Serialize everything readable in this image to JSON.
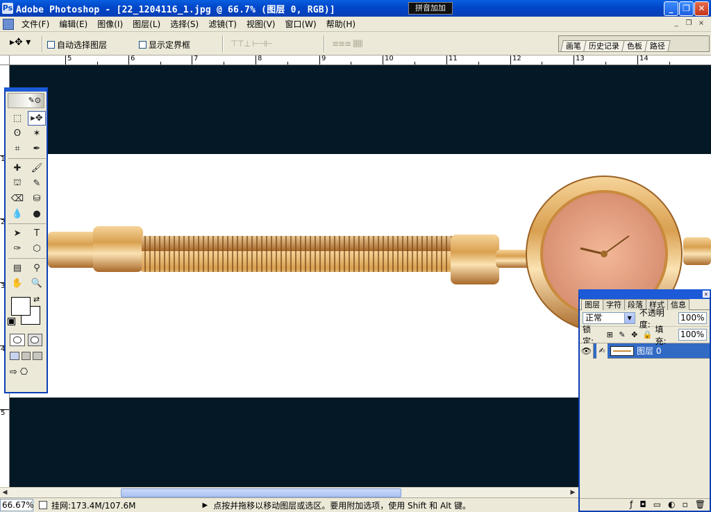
{
  "window": {
    "title": "Adobe Photoshop - [22_1204116_1.jpg @ 66.7% (图层 0, RGB)]",
    "ime_indicator": "拼音加加",
    "btn_min": "_",
    "btn_max": "❐",
    "btn_close": "✕"
  },
  "menu": {
    "items": [
      "文件(F)",
      "编辑(E)",
      "图像(I)",
      "图层(L)",
      "选择(S)",
      "滤镜(T)",
      "视图(V)",
      "窗口(W)",
      "帮助(H)"
    ],
    "doc_min": "_",
    "doc_restore": "❐",
    "doc_close": "×"
  },
  "options": {
    "tool_preset_icon": "move-tool-icon",
    "tool_preset_glyph": "▸✥ ▾",
    "auto_select_label": "自动选择图层",
    "show_bounds_label": "显示定界框",
    "align_glyphs": "⊤⊤⊥ ⊢⊣⊢",
    "distribute_glyphs": "≡≡≡ ⫼⫼⫼"
  },
  "palette_well": {
    "tabs": [
      "画笔",
      "历史记录",
      "色板",
      "路径"
    ]
  },
  "ruler": {
    "h_labels": [
      "5",
      "6",
      "7",
      "8",
      "9",
      "10",
      "11",
      "12",
      "13",
      "14"
    ],
    "v_labels": [
      "1",
      "2",
      "3",
      "4",
      "5"
    ]
  },
  "toolbox": {
    "header_glyph": "✎⊙",
    "tools": [
      {
        "name": "marquee-tool-icon",
        "glyph": "⬚",
        "active": false
      },
      {
        "name": "move-tool-icon",
        "glyph": "▸✥",
        "active": true
      },
      {
        "name": "lasso-tool-icon",
        "glyph": "ʘ",
        "active": false
      },
      {
        "name": "magic-wand-tool-icon",
        "glyph": "✶",
        "active": false
      },
      {
        "name": "crop-tool-icon",
        "glyph": "⌗",
        "active": false
      },
      {
        "name": "slice-tool-icon",
        "glyph": "✒",
        "active": false
      },
      {
        "name": "healing-brush-tool-icon",
        "glyph": "✚",
        "active": false
      },
      {
        "name": "brush-tool-icon",
        "glyph": "🖌",
        "active": false
      },
      {
        "name": "clone-stamp-tool-icon",
        "glyph": "⛫",
        "active": false
      },
      {
        "name": "history-brush-tool-icon",
        "glyph": "✎",
        "active": false
      },
      {
        "name": "eraser-tool-icon",
        "glyph": "⌫",
        "active": false
      },
      {
        "name": "paint-bucket-tool-icon",
        "glyph": "⛁",
        "active": false
      },
      {
        "name": "blur-tool-icon",
        "glyph": "💧",
        "active": false
      },
      {
        "name": "dodge-tool-icon",
        "glyph": "●",
        "active": false
      },
      {
        "name": "path-selection-tool-icon",
        "glyph": "➤",
        "active": false
      },
      {
        "name": "type-tool-icon",
        "glyph": "T",
        "active": false
      },
      {
        "name": "pen-tool-icon",
        "glyph": "✑",
        "active": false
      },
      {
        "name": "shape-tool-icon",
        "glyph": "⬡",
        "active": false
      },
      {
        "name": "notes-tool-icon",
        "glyph": "▤",
        "active": false
      },
      {
        "name": "eyedropper-tool-icon",
        "glyph": "⚲",
        "active": false
      },
      {
        "name": "hand-tool-icon",
        "glyph": "✋",
        "active": false
      },
      {
        "name": "zoom-tool-icon",
        "glyph": "🔍",
        "active": false
      }
    ],
    "swap_glyph": "⇄",
    "jump_glyphs": [
      "⇨",
      "⎔"
    ]
  },
  "layers_panel": {
    "close_glyph": "x",
    "tabs": [
      "图层",
      "字符",
      "段落",
      "样式",
      "信息"
    ],
    "blend_mode": "正常",
    "blend_dropdown_glyph": "▼",
    "opacity_label": "不透明度:",
    "opacity_value": "100%",
    "lock_label": "锁定:",
    "lock_glyphs": [
      "⊞",
      "✎",
      "✥",
      "🔒"
    ],
    "fill_label": "填充:",
    "fill_value": "100%",
    "layer": {
      "name": "图层 0",
      "visible_glyph": "👁",
      "brush_glyph": "✍"
    },
    "footer_glyphs": [
      "ƒ",
      "◘",
      "▭",
      "◐",
      "▫",
      "🗑"
    ]
  },
  "statusbar": {
    "zoom": "66.67%",
    "doc_info": "挂网:173.4M/107.6M",
    "play_glyph": "▶",
    "hint": "点按并拖移以移动图层或选区。要用附加选项，使用 Shift 和 Alt 键。"
  },
  "scrollbar": {
    "left_arrow": "◀",
    "right_arrow": "▶",
    "thumb_grip": "|||"
  },
  "colors": {
    "canvas_bg": "#041925",
    "title_blue": "#0046c8",
    "selection_blue": "#316ac5",
    "watch_gold": "#c98a3c"
  }
}
